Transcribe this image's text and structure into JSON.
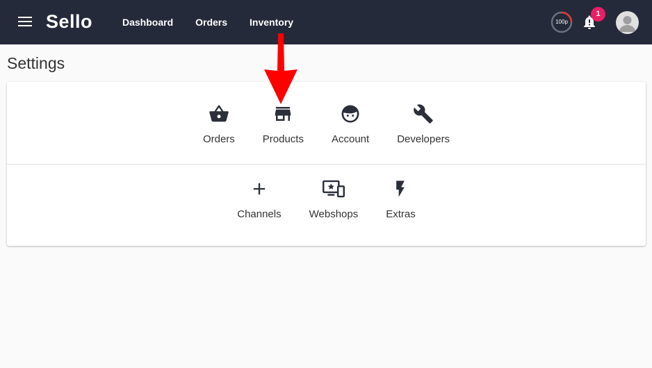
{
  "topbar": {
    "logo": "Sello",
    "nav": [
      {
        "label": "Dashboard"
      },
      {
        "label": "Orders"
      },
      {
        "label": "Inventory"
      }
    ],
    "progress_label": "100p",
    "notifications_count": "1",
    "bar_color": "#252a3b",
    "badge_color": "#e91e63",
    "progress_color": "#e53935"
  },
  "page": {
    "title": "Settings"
  },
  "settings": {
    "row1": [
      {
        "label": "Orders",
        "icon": "basket-icon"
      },
      {
        "label": "Products",
        "icon": "store-icon"
      },
      {
        "label": "Account",
        "icon": "face-icon"
      },
      {
        "label": "Developers",
        "icon": "wrench-icon"
      }
    ],
    "row2": [
      {
        "label": "Channels",
        "icon": "plus-icon"
      },
      {
        "label": "Webshops",
        "icon": "devices-star-icon"
      },
      {
        "label": "Extras",
        "icon": "lightning-icon"
      }
    ]
  },
  "annotation": {
    "arrow_color": "#ff0000",
    "icon": "red-arrow-down-icon"
  }
}
